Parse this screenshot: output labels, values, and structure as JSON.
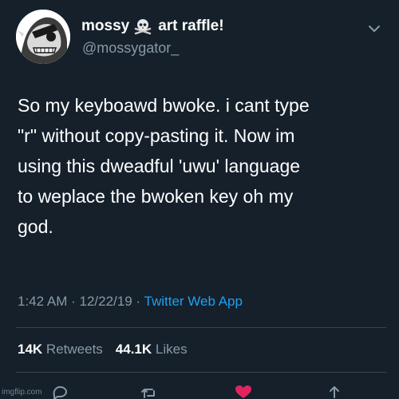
{
  "tweet": {
    "display_name": "mossy",
    "display_name_suffix": "art raffle!",
    "handle": "@mossygator_",
    "text": "So my keyboawd bwoke. i cant type\n\"r\" without copy-pasting it. Now im\nusing this dweadful 'uwu' language\nto weplace the bwoken key oh my\ngod.",
    "time": "1:42 AM",
    "date": "12/22/19",
    "source": "Twitter Web App",
    "retweets_count": "14K",
    "retweets_label": "Retweets",
    "likes_count": "44.1K",
    "likes_label": "Likes"
  },
  "watermark": "imgflip.com",
  "icons": {
    "emoji": "skull-and-crossbones-icon",
    "menu": "chevron-down-icon",
    "reply": "reply-icon",
    "retweet": "retweet-icon",
    "like": "heart-icon",
    "share": "share-icon"
  },
  "colors": {
    "background": "#15202b",
    "text": "#ffffff",
    "secondary_text": "#8899a6",
    "link": "#1da1f2",
    "like": "#e0245e",
    "divider": "#38444d"
  }
}
